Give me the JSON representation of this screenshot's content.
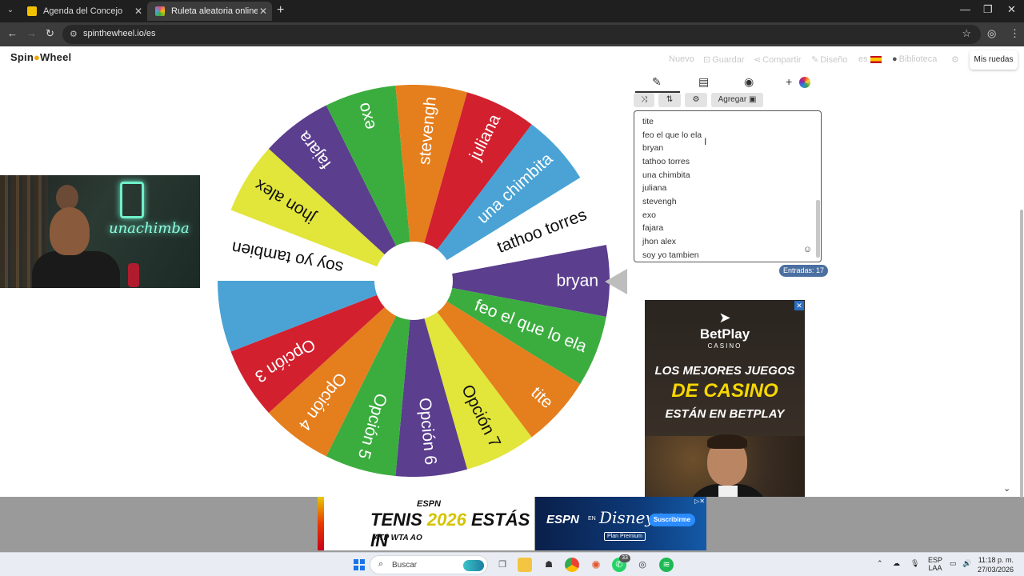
{
  "browser": {
    "tabs": [
      {
        "title": "Agenda del Concejo",
        "icon_color": "#f2c200"
      },
      {
        "title": "Ruleta aleatoria online – ruleta",
        "icon_color": "#e04a8c"
      }
    ],
    "url": "spinthewheel.io/es"
  },
  "site": {
    "logo_part1": "Spin",
    "logo_part2": "Wheel",
    "nav": {
      "nuevo": "Nuevo",
      "guardar": "Guardar",
      "compartir": "Compartir",
      "diseno": "Diseño",
      "lang": "es",
      "biblioteca": "Biblioteca",
      "mis_ruedas": "Mis ruedas"
    }
  },
  "wheel": {
    "segments": [
      {
        "label": "bryan",
        "color": "#5b3e8e"
      },
      {
        "label": "feo el que lo ela",
        "color": "#3bad3f"
      },
      {
        "label": "tite",
        "color": "#e57e1d"
      },
      {
        "label": "Opción 7",
        "color": "#e2e53a"
      },
      {
        "label": "Opción 6",
        "color": "#5b3e8e"
      },
      {
        "label": "Opción 5",
        "color": "#3bad3f"
      },
      {
        "label": "Opción 4",
        "color": "#e57e1d"
      },
      {
        "label": "Opción 3",
        "color": "#d2202f"
      },
      {
        "label": "",
        "color": "#4aa3d4"
      },
      {
        "label": "soy yo tambien",
        "color": "#ffffff"
      },
      {
        "label": "jhon alex",
        "color": "#e2e53a"
      },
      {
        "label": "fajara",
        "color": "#5b3e8e"
      },
      {
        "label": "exo",
        "color": "#3bad3f"
      },
      {
        "label": "stevengh",
        "color": "#e57e1d"
      },
      {
        "label": "juliana",
        "color": "#d2202f"
      },
      {
        "label": "una chimbita",
        "color": "#4aa3d4"
      },
      {
        "label": "tathoo torres",
        "color": "#ffffff"
      }
    ]
  },
  "editor": {
    "add_label": "Agregar",
    "entries": [
      "tite",
      "feo el que lo ela",
      "bryan",
      "tathoo torres",
      "una chimbita",
      "juliana",
      "stevengh",
      "exo",
      "fajara",
      "jhon alex",
      "soy yo tambien"
    ],
    "entries_count": "Entradas: 17"
  },
  "webcam": {
    "neon_text": "unachimba"
  },
  "ads": {
    "right": {
      "brand": "BetPlay",
      "brand_sub": "CASINO",
      "line1": "LOS MEJORES JUEGOS",
      "line2": "DE CASINO",
      "line3": "ESTÁN EN BETPLAY"
    },
    "bottom_espn": {
      "espn": "ESPN",
      "tenis": "TENIS",
      "year": "2026",
      "estas": "ESTÁS IN",
      "logos": "ATP WTA AO"
    },
    "bottom_disney": {
      "espn": "ESPN",
      "en": "EN",
      "disney": "Disney+",
      "premium": "Plan Premium",
      "subscribe": "Suscribirme"
    }
  },
  "taskbar": {
    "search": "Buscar",
    "lang_top": "ESP",
    "lang_bottom": "LAA",
    "time": "11:18 p. m.",
    "date": "27/03/2026",
    "whatsapp_badge": "33"
  }
}
